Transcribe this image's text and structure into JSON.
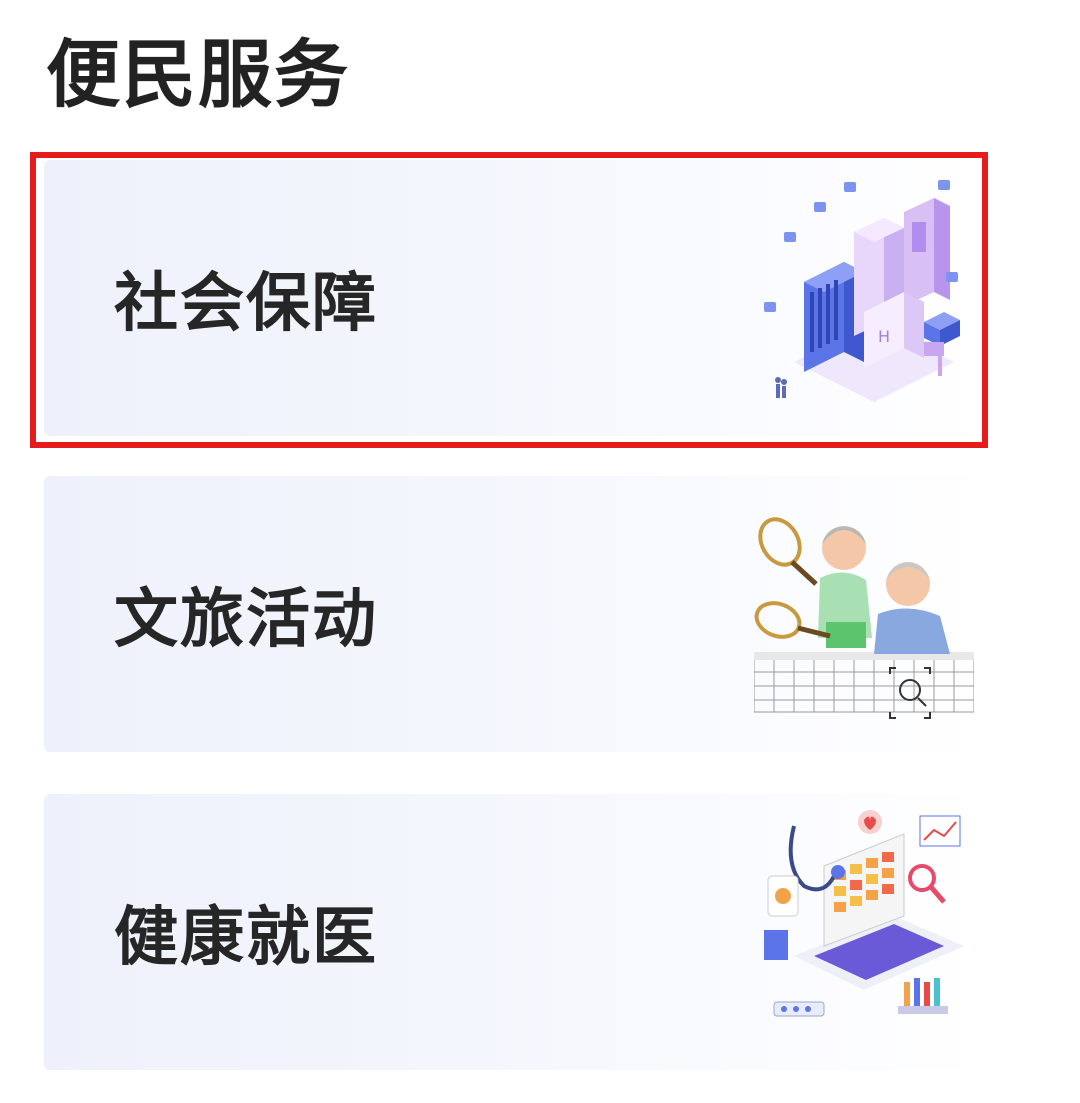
{
  "section": {
    "title": "便民服务"
  },
  "cards": [
    {
      "label": "社会保障",
      "icon": "city-buildings-icon"
    },
    {
      "label": "文旅活动",
      "icon": "elderly-tennis-icon"
    },
    {
      "label": "健康就医",
      "icon": "medical-laptop-icon"
    }
  ],
  "highlight": {
    "color": "#e61b1b",
    "target": "社会保障"
  },
  "colors": {
    "card_bg": "#eef1fb",
    "text": "#262626"
  }
}
